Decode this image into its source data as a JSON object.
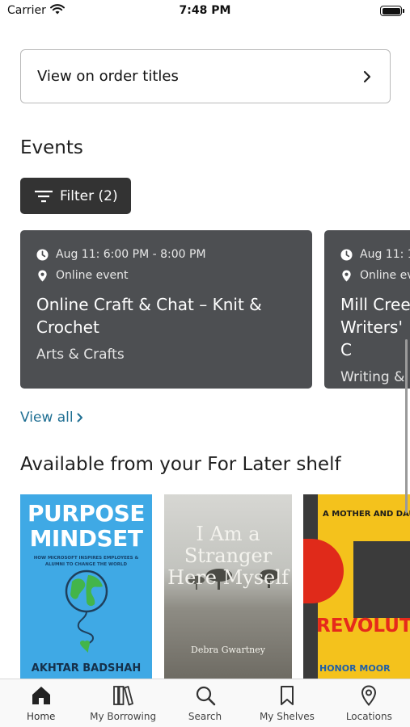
{
  "status": {
    "carrier": "Carrier",
    "time": "7:48 PM"
  },
  "order": {
    "label": "View on order titles"
  },
  "events": {
    "title": "Events",
    "filter_label": "Filter (2)",
    "cards": [
      {
        "time": "Aug 11: 6:00 PM - 8:00 PM",
        "location": "Online event",
        "title": "Online Craft & Chat – Knit & Crochet",
        "category": "Arts & Crafts"
      },
      {
        "time": "Aug 11: 1",
        "location": "Online ev",
        "title": "Mill Cree Writers' C",
        "category": "Writing &"
      }
    ],
    "view_all": "View all"
  },
  "shelf": {
    "title": "Available from your For Later shelf",
    "books": [
      {
        "title": "PURPOSE MINDSET",
        "subtitle": "HOW MICROSOFT INSPIRES EMPLOYEES & ALUMNI TO CHANGE THE WORLD",
        "author": "AKHTAR BADSHAH"
      },
      {
        "title": "I Am a Stranger Here Myself",
        "author": "Debra Gwartney"
      },
      {
        "top_text": "A MOTHER AND DAUG AT MIDCENTURY",
        "title": "REVOLUTI",
        "author": "HONOR MOOR"
      }
    ]
  },
  "tabs": [
    {
      "label": "Home",
      "icon": "home-icon"
    },
    {
      "label": "My Borrowing",
      "icon": "books-icon"
    },
    {
      "label": "Search",
      "icon": "search-icon"
    },
    {
      "label": "My Shelves",
      "icon": "bookmark-icon"
    },
    {
      "label": "Locations",
      "icon": "location-pin-icon"
    }
  ],
  "colors": {
    "accent_link": "#1f6f93",
    "card_bg": "#4d4f52",
    "filter_bg": "#333333"
  }
}
